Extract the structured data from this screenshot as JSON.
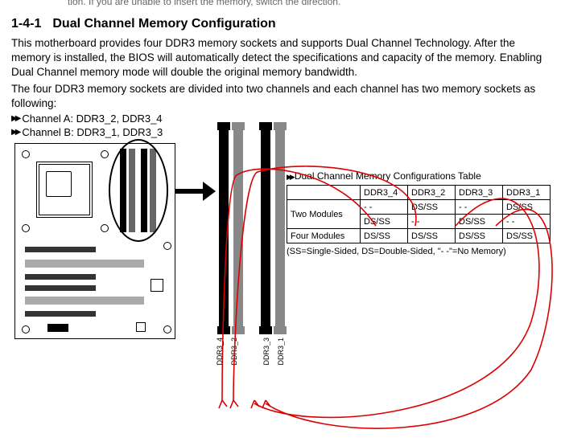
{
  "cropped_line": "tion. If you are unable to insert the memory, switch the direction.",
  "section_number": "1-4-1",
  "section_title": "Dual Channel Memory Configuration",
  "paragraph1": "This motherboard provides four DDR3 memory sockets and supports Dual Channel Technology. After the memory is installed, the BIOS will automatically detect the specifications and capacity of the memory. Enabling Dual Channel memory mode will double the original memory bandwidth.",
  "paragraph2": "The four DDR3 memory sockets are divided into two channels and each channel has two memory sockets as following:",
  "channel_a": "Channel A: DDR3_2, DDR3_4",
  "channel_b": "Channel B: DDR3_1, DDR3_3",
  "slot_labels": [
    "DDR3_4",
    "DDR3_2",
    "DDR3_3",
    "DDR3_1"
  ],
  "table_title": "Dual Channel Memory Configurations Table",
  "table": {
    "headers": [
      "",
      "DDR3_4",
      "DDR3_2",
      "DDR3_3",
      "DDR3_1"
    ],
    "rows": [
      {
        "label": "Two Modules",
        "cells": [
          "- -",
          "DS/SS",
          "- -",
          "DS/SS"
        ]
      },
      {
        "label": "",
        "cells": [
          "DS/SS",
          "- -",
          "DS/SS",
          "- -"
        ]
      },
      {
        "label": "Four Modules",
        "cells": [
          "DS/SS",
          "DS/SS",
          "DS/SS",
          "DS/SS"
        ]
      }
    ]
  },
  "legend": "(SS=Single-Sided, DS=Double-Sided, \"- -\"=No Memory)"
}
